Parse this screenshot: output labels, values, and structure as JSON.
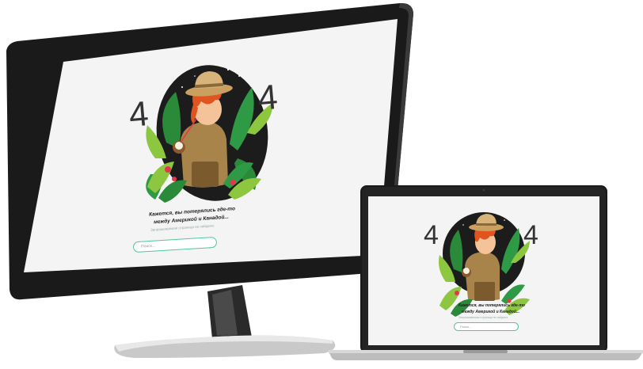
{
  "monitor": {
    "error_left_digit": "4",
    "error_right_digit": "4",
    "caption_line1": "Кажется, вы потерялись где-то",
    "caption_line2": "между Америкой и Канадой...",
    "caption_sub": "Запрашиваемая страница не найдена.",
    "search_placeholder": "Поиск...",
    "search_icon": "search-icon"
  },
  "laptop": {
    "error_left_digit": "4",
    "error_right_digit": "4",
    "caption_line1": "Кажется, вы потерялись где-то",
    "caption_line2": "между Америкой и Канадой...",
    "caption_sub": "Запрашиваемая страница не найдена.",
    "search_placeholder": "Поиск...",
    "search_icon": "search-icon"
  },
  "colors": {
    "accent": "#51c79b",
    "device_frame": "#1f1f1f",
    "screen_bg": "#f3f3f3",
    "night_circle": "#1c1c1c",
    "hat": "#d8b37a",
    "hair": "#e0541f",
    "leaf_dark": "#2a8a3a",
    "leaf_light": "#8dc63f",
    "flower": "#e8354a"
  }
}
